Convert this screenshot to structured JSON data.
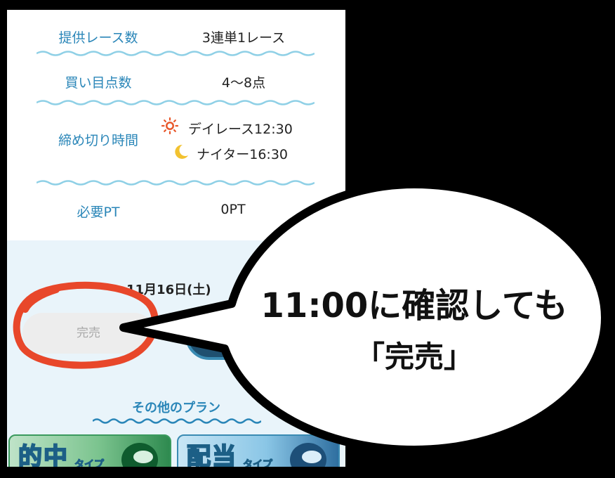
{
  "info_rows": [
    {
      "label": "提供レース数",
      "value": "3連単1レース"
    },
    {
      "label": "買い目点数",
      "value": "4〜8点"
    },
    {
      "label": "締め切り時間",
      "day": "デイレース12:30",
      "night": "ナイター16:30"
    },
    {
      "label": "必要PT",
      "value": "0PT"
    }
  ],
  "date": "11月16日(土)",
  "sold_button": "完売",
  "other_plans_heading": "その他のプラン",
  "cards": [
    {
      "big": "的中",
      "small": "タイプ"
    },
    {
      "big": "配当",
      "small": "タイプ"
    }
  ],
  "callout": {
    "line1": "11:00に確認しても",
    "line2": "「完売」"
  },
  "colors": {
    "accent": "#2a86b8",
    "annotation": "#e8472a",
    "wave": "#8fd0e6"
  }
}
